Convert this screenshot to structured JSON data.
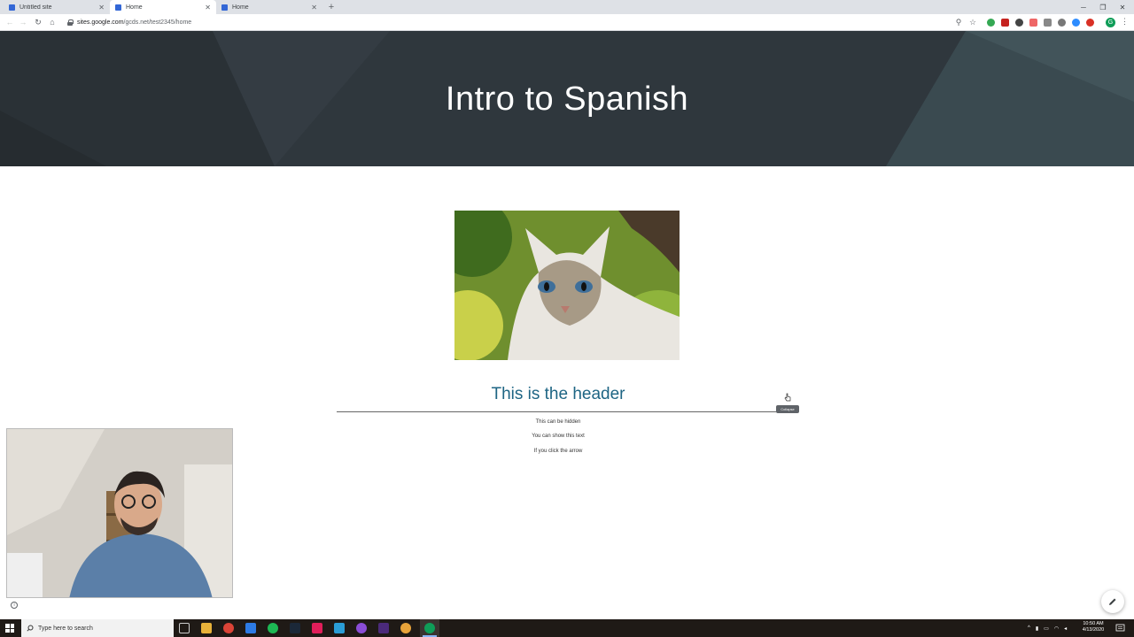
{
  "browser": {
    "tabs": [
      {
        "title": "Untitled site",
        "active": false
      },
      {
        "title": "Home",
        "active": true
      },
      {
        "title": "Home",
        "active": false
      }
    ],
    "url_host": "sites.google.com",
    "url_path": "/gcds.net/test2345/home",
    "profile_initial": "G"
  },
  "site": {
    "title": "Intro to Spanish",
    "collapsible": {
      "header": "This is the header",
      "tooltip": "Collapse",
      "lines": [
        "This can be hidden",
        "You can show this text",
        "If you click the arrow"
      ]
    }
  },
  "taskbar": {
    "search_placeholder": "Type here to search",
    "time": "10:50 AM",
    "date": "4/13/2020"
  },
  "colors": {
    "banner": "#2f373d",
    "header_text": "#1e6584",
    "accent": "#3367d6"
  }
}
